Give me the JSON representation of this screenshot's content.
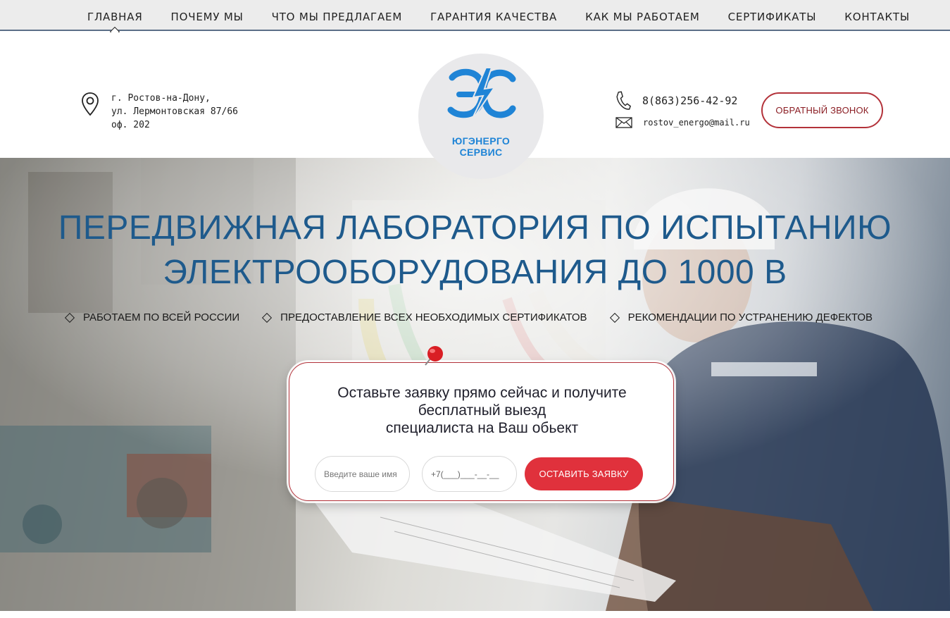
{
  "nav": {
    "items": [
      {
        "label": "ГЛАВНАЯ",
        "active": true
      },
      {
        "label": "ПОЧЕМУ МЫ"
      },
      {
        "label": "ЧТО МЫ ПРЕДЛАГАЕМ"
      },
      {
        "label": "ГАРАНТИЯ КАЧЕСТВА"
      },
      {
        "label": "КАК МЫ РАБОТАЕМ"
      },
      {
        "label": "СЕРТИФИКАТЫ"
      },
      {
        "label": "КОНТАКТЫ"
      }
    ]
  },
  "header": {
    "address": {
      "icon": "location-pin-icon",
      "lines": [
        "г. Ростов-на-Дону,",
        "ул. Лермонтовская 87/66",
        "оф. 202"
      ]
    },
    "logo": {
      "line1": "ЮГЭНЕРГО",
      "line2": "СЕРВИС",
      "color": "#1f84d6"
    },
    "phone": {
      "icon": "phone-icon",
      "value": "8(863)256-42-92"
    },
    "email": {
      "icon": "envelope-icon",
      "value": "rostov_energo@mail.ru"
    },
    "callback_label": "ОБРАТНЫЙ ЗВОНОК"
  },
  "hero": {
    "title_line1": "ПЕРЕДВИЖНАЯ ЛАБОРАТОРИЯ ПО ИСПЫТАНИЮ",
    "title_line2": "ЭЛЕКТРООБОРУДОВАНИЯ ДО 1000 В",
    "features": [
      "РАБОТАЕМ ПО ВСЕЙ РОССИИ",
      "ПРЕДОСТАВЛЕНИЕ ВСЕХ НЕОБХОДИМЫХ СЕРТИФИКАТОВ",
      "РЕКОМЕНДАЦИИ ПО УСТРАНЕНИЮ ДЕФЕКТОВ"
    ]
  },
  "form": {
    "text_line1": "Оставьте заявку прямо сейчас и получите",
    "text_line2": "бесплатный выезд",
    "text_line3": "специалиста на Ваш обьект",
    "name_placeholder": "Введите ваше имя",
    "phone_placeholder": "+7(___)___-__-__",
    "submit_label": "ОСТАВИТЬ ЗАЯВКУ"
  },
  "colors": {
    "accent_red": "#e0313c",
    "title_blue": "#1e5a8c",
    "logo_blue": "#1f84d6"
  }
}
